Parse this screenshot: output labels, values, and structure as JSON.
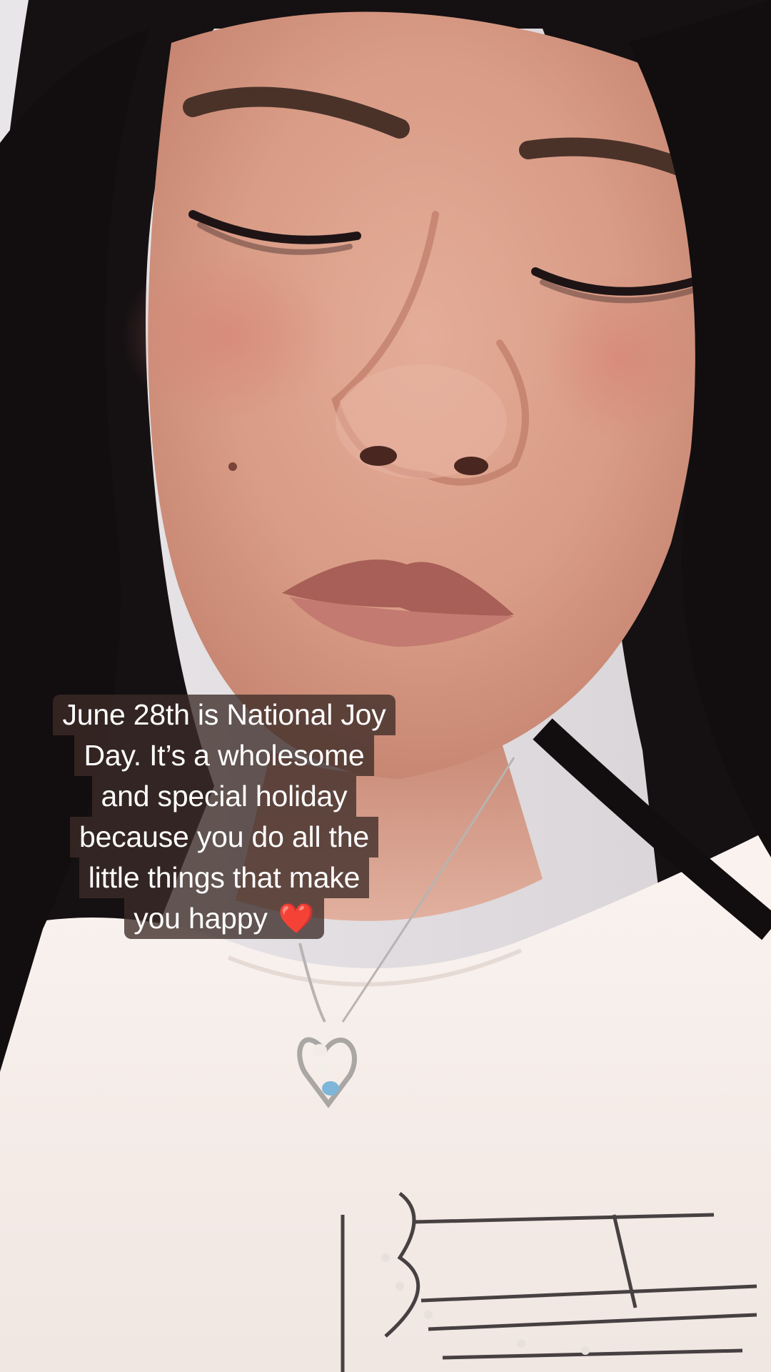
{
  "caption": {
    "lines": [
      "June 28th is National Joy",
      "Day. It’s a wholesome",
      "and special holiday",
      "because you do all the",
      "little things that make",
      "you happy"
    ],
    "emoji": "❤️"
  },
  "colors": {
    "caption_text": "#ffffff",
    "caption_background": "#3c2c28",
    "heart": "#e0192d",
    "shirt": "#f7efe9",
    "hair": "#151012",
    "skin": "#d9a28e"
  }
}
